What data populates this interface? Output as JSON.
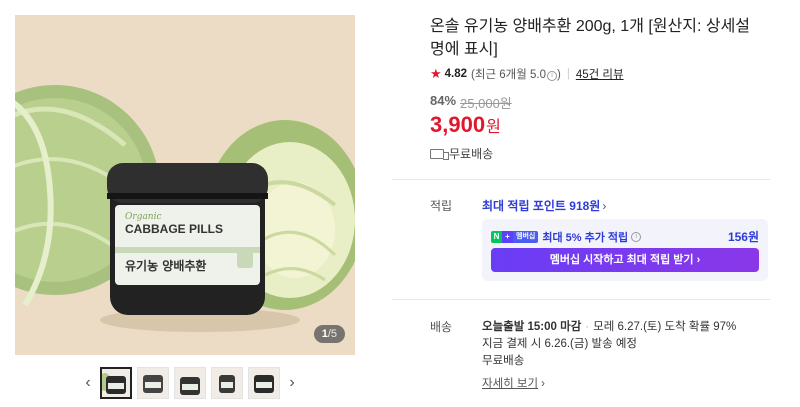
{
  "gallery": {
    "label_brand": "Organic",
    "label_title": "CABBAGE PILLS",
    "label_product": "유기농 양배추환",
    "indicator_current": "1",
    "indicator_total": "/5",
    "prev_arrow": "‹",
    "next_arrow": "›"
  },
  "product": {
    "title": "온솔 유기농 양배추환 200g, 1개 [원산지: 상세설명에 표시]",
    "rating_score": "4.82",
    "rating_note": "(최근 6개월 5.0",
    "rating_note_close": ")",
    "review_link": "45건 리뷰",
    "discount_rate": "84%",
    "original_price": "25,000원",
    "price": "3,900",
    "currency": "원",
    "shipping_badge": "무료배송"
  },
  "reward": {
    "label": "적립",
    "max_points": "최대 적립 포인트 918원",
    "badge_n": "N",
    "badge_plus": "+",
    "badge_membership": "멤버십",
    "membership_text": "최대 5% 추가 적립",
    "membership_points": "156원",
    "membership_button": "멤버십 시작하고 최대 적립 받기 ›"
  },
  "delivery": {
    "label": "배송",
    "today_ship": "오늘출발 15:00 마감",
    "arrival": "모레 6.27.(토) 도착 확률 97%",
    "pay_now": "지금 결제 시 6.26.(금) 발송 예정",
    "free_shipping": "무료배송",
    "details_link": "자세히 보기"
  },
  "colors": {
    "price_red": "#e0182d",
    "link_blue": "#2e3bd6",
    "membership_purple": "#7a3af0"
  }
}
